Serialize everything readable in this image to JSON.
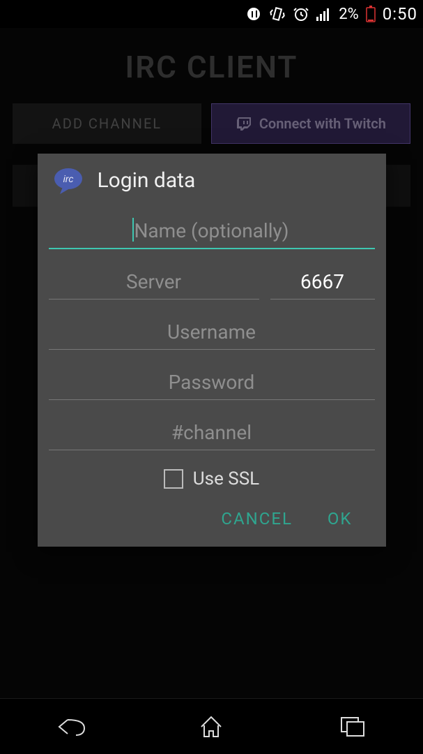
{
  "status_bar": {
    "battery_percent": "2%",
    "time": "0:50"
  },
  "app": {
    "title": "IRC CLIENT",
    "add_channel_label": "ADD CHANNEL",
    "twitch_label": "Connect with Twitch"
  },
  "dialog": {
    "title": "Login data",
    "irc_bubble_text": "irc",
    "fields": {
      "name": {
        "placeholder": "Name (optionally)",
        "value": ""
      },
      "server": {
        "placeholder": "Server",
        "value": ""
      },
      "port": {
        "placeholder": "",
        "value": "6667"
      },
      "username": {
        "placeholder": "Username",
        "value": ""
      },
      "password": {
        "placeholder": "Password",
        "value": ""
      },
      "channel": {
        "placeholder": "#channel",
        "value": ""
      }
    },
    "ssl_label": "Use SSL",
    "ssl_checked": false,
    "actions": {
      "cancel": "CANCEL",
      "ok": "OK"
    }
  }
}
